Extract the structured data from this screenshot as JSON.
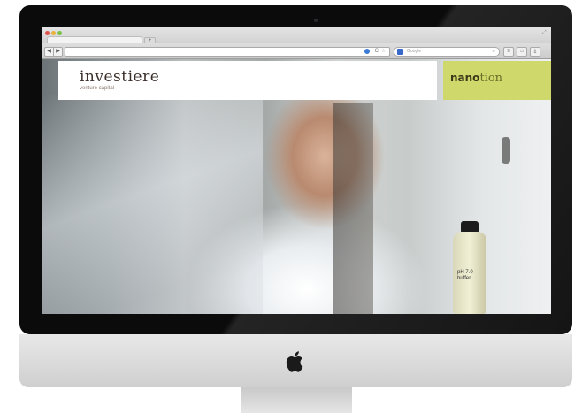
{
  "browser": {
    "new_tab": "+",
    "back": "◀",
    "forward": "▶",
    "reload": "C",
    "search_placeholder": "Google",
    "toolbar_buttons": [
      "≡",
      "⌂",
      "⤓"
    ]
  },
  "site": {
    "brand_name": "investiere",
    "brand_tagline": "venture capital",
    "partner_prefix": "nano",
    "partner_suffix": "tion",
    "bottle_label": "pH 7.0 buffer"
  },
  "colors": {
    "partner_bg": "#cfd86a",
    "brand_text": "#3a2e2a"
  }
}
